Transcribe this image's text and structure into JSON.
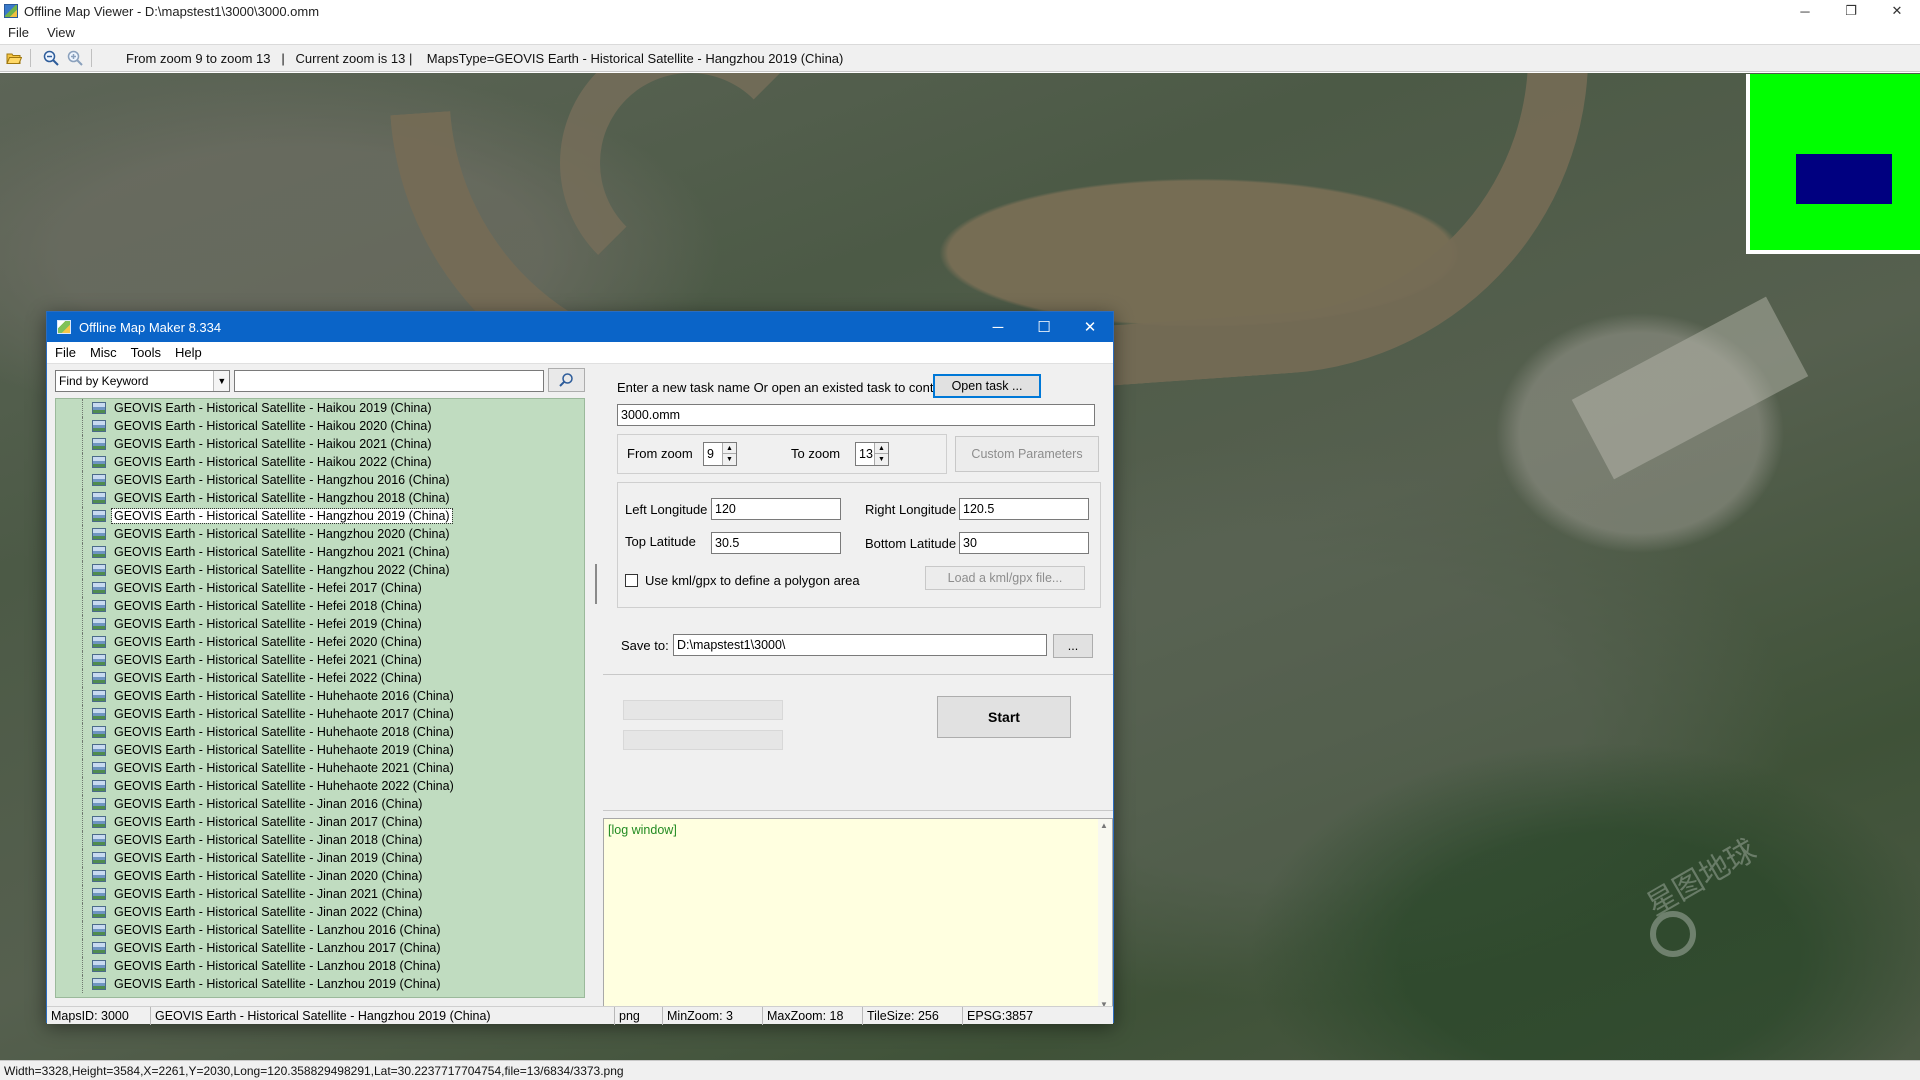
{
  "window": {
    "title": "Offline Map Viewer - D:\\mapstest1\\3000\\3000.omm",
    "controls": {
      "minimize": "─",
      "restore": "❐",
      "close": "✕"
    }
  },
  "menu": {
    "file": "File",
    "view": "View"
  },
  "toolbar": {
    "info": "From zoom 9 to zoom 13   |   Current zoom is 13 |    MapsType=GEOVIS Earth - Historical Satellite - Hangzhou 2019 (China)"
  },
  "map": {
    "watermark": "星图地球"
  },
  "status": "Width=3328,Height=3584,X=2261,Y=2030,Long=120.358829498291,Lat=30.2237717704754,file=13/6834/3373.png",
  "dialog": {
    "title": "Offline Map Maker 8.334",
    "menu": {
      "file": "File",
      "misc": "Misc",
      "tools": "Tools",
      "help": "Help"
    },
    "find_mode": "Find by Keyword",
    "search_value": "",
    "tree_items": [
      "GEOVIS Earth - Historical Satellite - Haikou 2019 (China)",
      "GEOVIS Earth - Historical Satellite - Haikou 2020 (China)",
      "GEOVIS Earth - Historical Satellite - Haikou 2021 (China)",
      "GEOVIS Earth - Historical Satellite - Haikou 2022 (China)",
      "GEOVIS Earth - Historical Satellite - Hangzhou 2016 (China)",
      "GEOVIS Earth - Historical Satellite - Hangzhou 2018 (China)",
      "GEOVIS Earth - Historical Satellite - Hangzhou 2019 (China)",
      "GEOVIS Earth - Historical Satellite - Hangzhou 2020 (China)",
      "GEOVIS Earth - Historical Satellite - Hangzhou 2021 (China)",
      "GEOVIS Earth - Historical Satellite - Hangzhou 2022 (China)",
      "GEOVIS Earth - Historical Satellite - Hefei 2017 (China)",
      "GEOVIS Earth - Historical Satellite - Hefei 2018 (China)",
      "GEOVIS Earth - Historical Satellite - Hefei 2019 (China)",
      "GEOVIS Earth - Historical Satellite - Hefei 2020 (China)",
      "GEOVIS Earth - Historical Satellite - Hefei 2021 (China)",
      "GEOVIS Earth - Historical Satellite - Hefei 2022 (China)",
      "GEOVIS Earth - Historical Satellite - Huhehaote 2016 (China)",
      "GEOVIS Earth - Historical Satellite - Huhehaote 2017 (China)",
      "GEOVIS Earth - Historical Satellite - Huhehaote 2018 (China)",
      "GEOVIS Earth - Historical Satellite - Huhehaote 2019 (China)",
      "GEOVIS Earth - Historical Satellite - Huhehaote 2021 (China)",
      "GEOVIS Earth - Historical Satellite - Huhehaote 2022 (China)",
      "GEOVIS Earth - Historical Satellite - Jinan 2016 (China)",
      "GEOVIS Earth - Historical Satellite - Jinan 2017 (China)",
      "GEOVIS Earth - Historical Satellite - Jinan 2018 (China)",
      "GEOVIS Earth - Historical Satellite - Jinan 2019 (China)",
      "GEOVIS Earth - Historical Satellite - Jinan 2020 (China)",
      "GEOVIS Earth - Historical Satellite - Jinan 2021 (China)",
      "GEOVIS Earth - Historical Satellite - Jinan 2022 (China)",
      "GEOVIS Earth - Historical Satellite - Lanzhou 2016 (China)",
      "GEOVIS Earth - Historical Satellite - Lanzhou 2017 (China)",
      "GEOVIS Earth - Historical Satellite - Lanzhou 2018 (China)",
      "GEOVIS Earth - Historical Satellite - Lanzhou 2019 (China)"
    ],
    "selected_item": "GEOVIS Earth - Historical Satellite - Hangzhou 2019 (China)",
    "task_prompt": "Enter a new task name Or open an existed task to continue:",
    "open_task_label": "Open task ...",
    "task_name": "3000.omm",
    "from_zoom_label": "From zoom",
    "from_zoom": "9",
    "to_zoom_label": "To zoom",
    "to_zoom": "13",
    "custom_params_label": "Custom Parameters",
    "left_lon_label": "Left Longitude",
    "left_lon": "120",
    "right_lon_label": "Right Longitude",
    "right_lon": "120.5",
    "top_lat_label": "Top Latitude",
    "top_lat": "30.5",
    "bottom_lat_label": "Bottom Latitude",
    "bottom_lat": "30",
    "kml_label": "Use kml/gpx to define a polygon area",
    "load_kml_label": "Load a kml/gpx file...",
    "save_to_label": "Save to:",
    "save_to": "D:\\mapstest1\\3000\\",
    "browse_label": "...",
    "start_label": "Start",
    "log_text": "[log window]",
    "status": {
      "maps_id": "MapsID: 3000",
      "maps_name": "GEOVIS Earth - Historical Satellite - Hangzhou 2019 (China)",
      "format": "png",
      "min_zoom": "MinZoom: 3",
      "max_zoom": "MaxZoom: 18",
      "tile_size": "TileSize: 256",
      "epsg": "EPSG:3857"
    }
  }
}
